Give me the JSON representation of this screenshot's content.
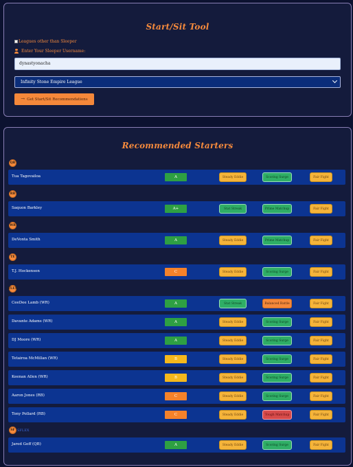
{
  "tool": {
    "title": "Start/Sit Tool",
    "checkbox_label": "Leagues other than Sleeper",
    "username_label": "Enter Your Sleeper Username:",
    "username_value": "dynastyonacha",
    "league_selected": "Infinity Stone Empire League",
    "button_label": "Get Start/Sit Recommendations"
  },
  "starters": {
    "title": "Recommended Starters",
    "positions": [
      "QB",
      "RB",
      "WR",
      "TE",
      "FLEX"
    ],
    "superflex_label": "SFLEX",
    "superflex_badge": "SF",
    "rows": [
      {
        "name": "Tua Tagovailoa",
        "grade": "A",
        "t1": "Steady Eddie",
        "t2": "Scoring Surge",
        "t3": "Fair Fight"
      },
      {
        "name": "Saquon Barkley",
        "grade": "A+",
        "t1": "Stat Streak",
        "t2": "Prime Matchup",
        "t3": "Fair Fight"
      },
      {
        "name": "DeVonta Smith",
        "grade": "A",
        "t1": "Steady Eddie",
        "t2": "Prime Matchup",
        "t3": "Fair Fight"
      },
      {
        "name": "T.J. Hockenson",
        "grade": "C",
        "t1": "Steady Eddie",
        "t2": "Scoring Surge",
        "t3": "Fair Fight"
      },
      {
        "name": "CeeDee Lamb (WR)",
        "grade": "A",
        "t1": "Stat Streak",
        "t2": "Balanced Battle",
        "t3": "Fair Fight"
      },
      {
        "name": "Davante Adams (WR)",
        "grade": "A",
        "t1": "Steady Eddie",
        "t2": "Scoring Surge",
        "t3": "Fair Fight"
      },
      {
        "name": "DJ Moore (WR)",
        "grade": "A",
        "t1": "Steady Eddie",
        "t2": "Scoring Surge",
        "t3": "Fair Fight"
      },
      {
        "name": "Tetairoa McMillan (WR)",
        "grade": "B",
        "t1": "Steady Eddie",
        "t2": "Scoring Surge",
        "t3": "Fair Fight"
      },
      {
        "name": "Keenan Allen (WR)",
        "grade": "B",
        "t1": "Steady Eddie",
        "t2": "Scoring Surge",
        "t3": "Fair Fight"
      },
      {
        "name": "Aaron Jones (RB)",
        "grade": "C",
        "t1": "Steady Eddie",
        "t2": "Scoring Surge",
        "t3": "Fair Fight"
      },
      {
        "name": "Tony Pollard (RB)",
        "grade": "C",
        "t1": "Steady Eddie",
        "t2": "Tough Matchup",
        "t3": "Fair Fight"
      },
      {
        "name": "Jared Goff (QB)",
        "grade": "A",
        "t1": "Steady Eddie",
        "t2": "Scoring Surge",
        "t3": "Fair Fight"
      }
    ]
  },
  "colors": {
    "accent": "#f58a3c",
    "grade_a": "#2ea043",
    "grade_b": "#f5b81c",
    "grade_c": "#f5822a",
    "row_bg": "#0c3491"
  }
}
